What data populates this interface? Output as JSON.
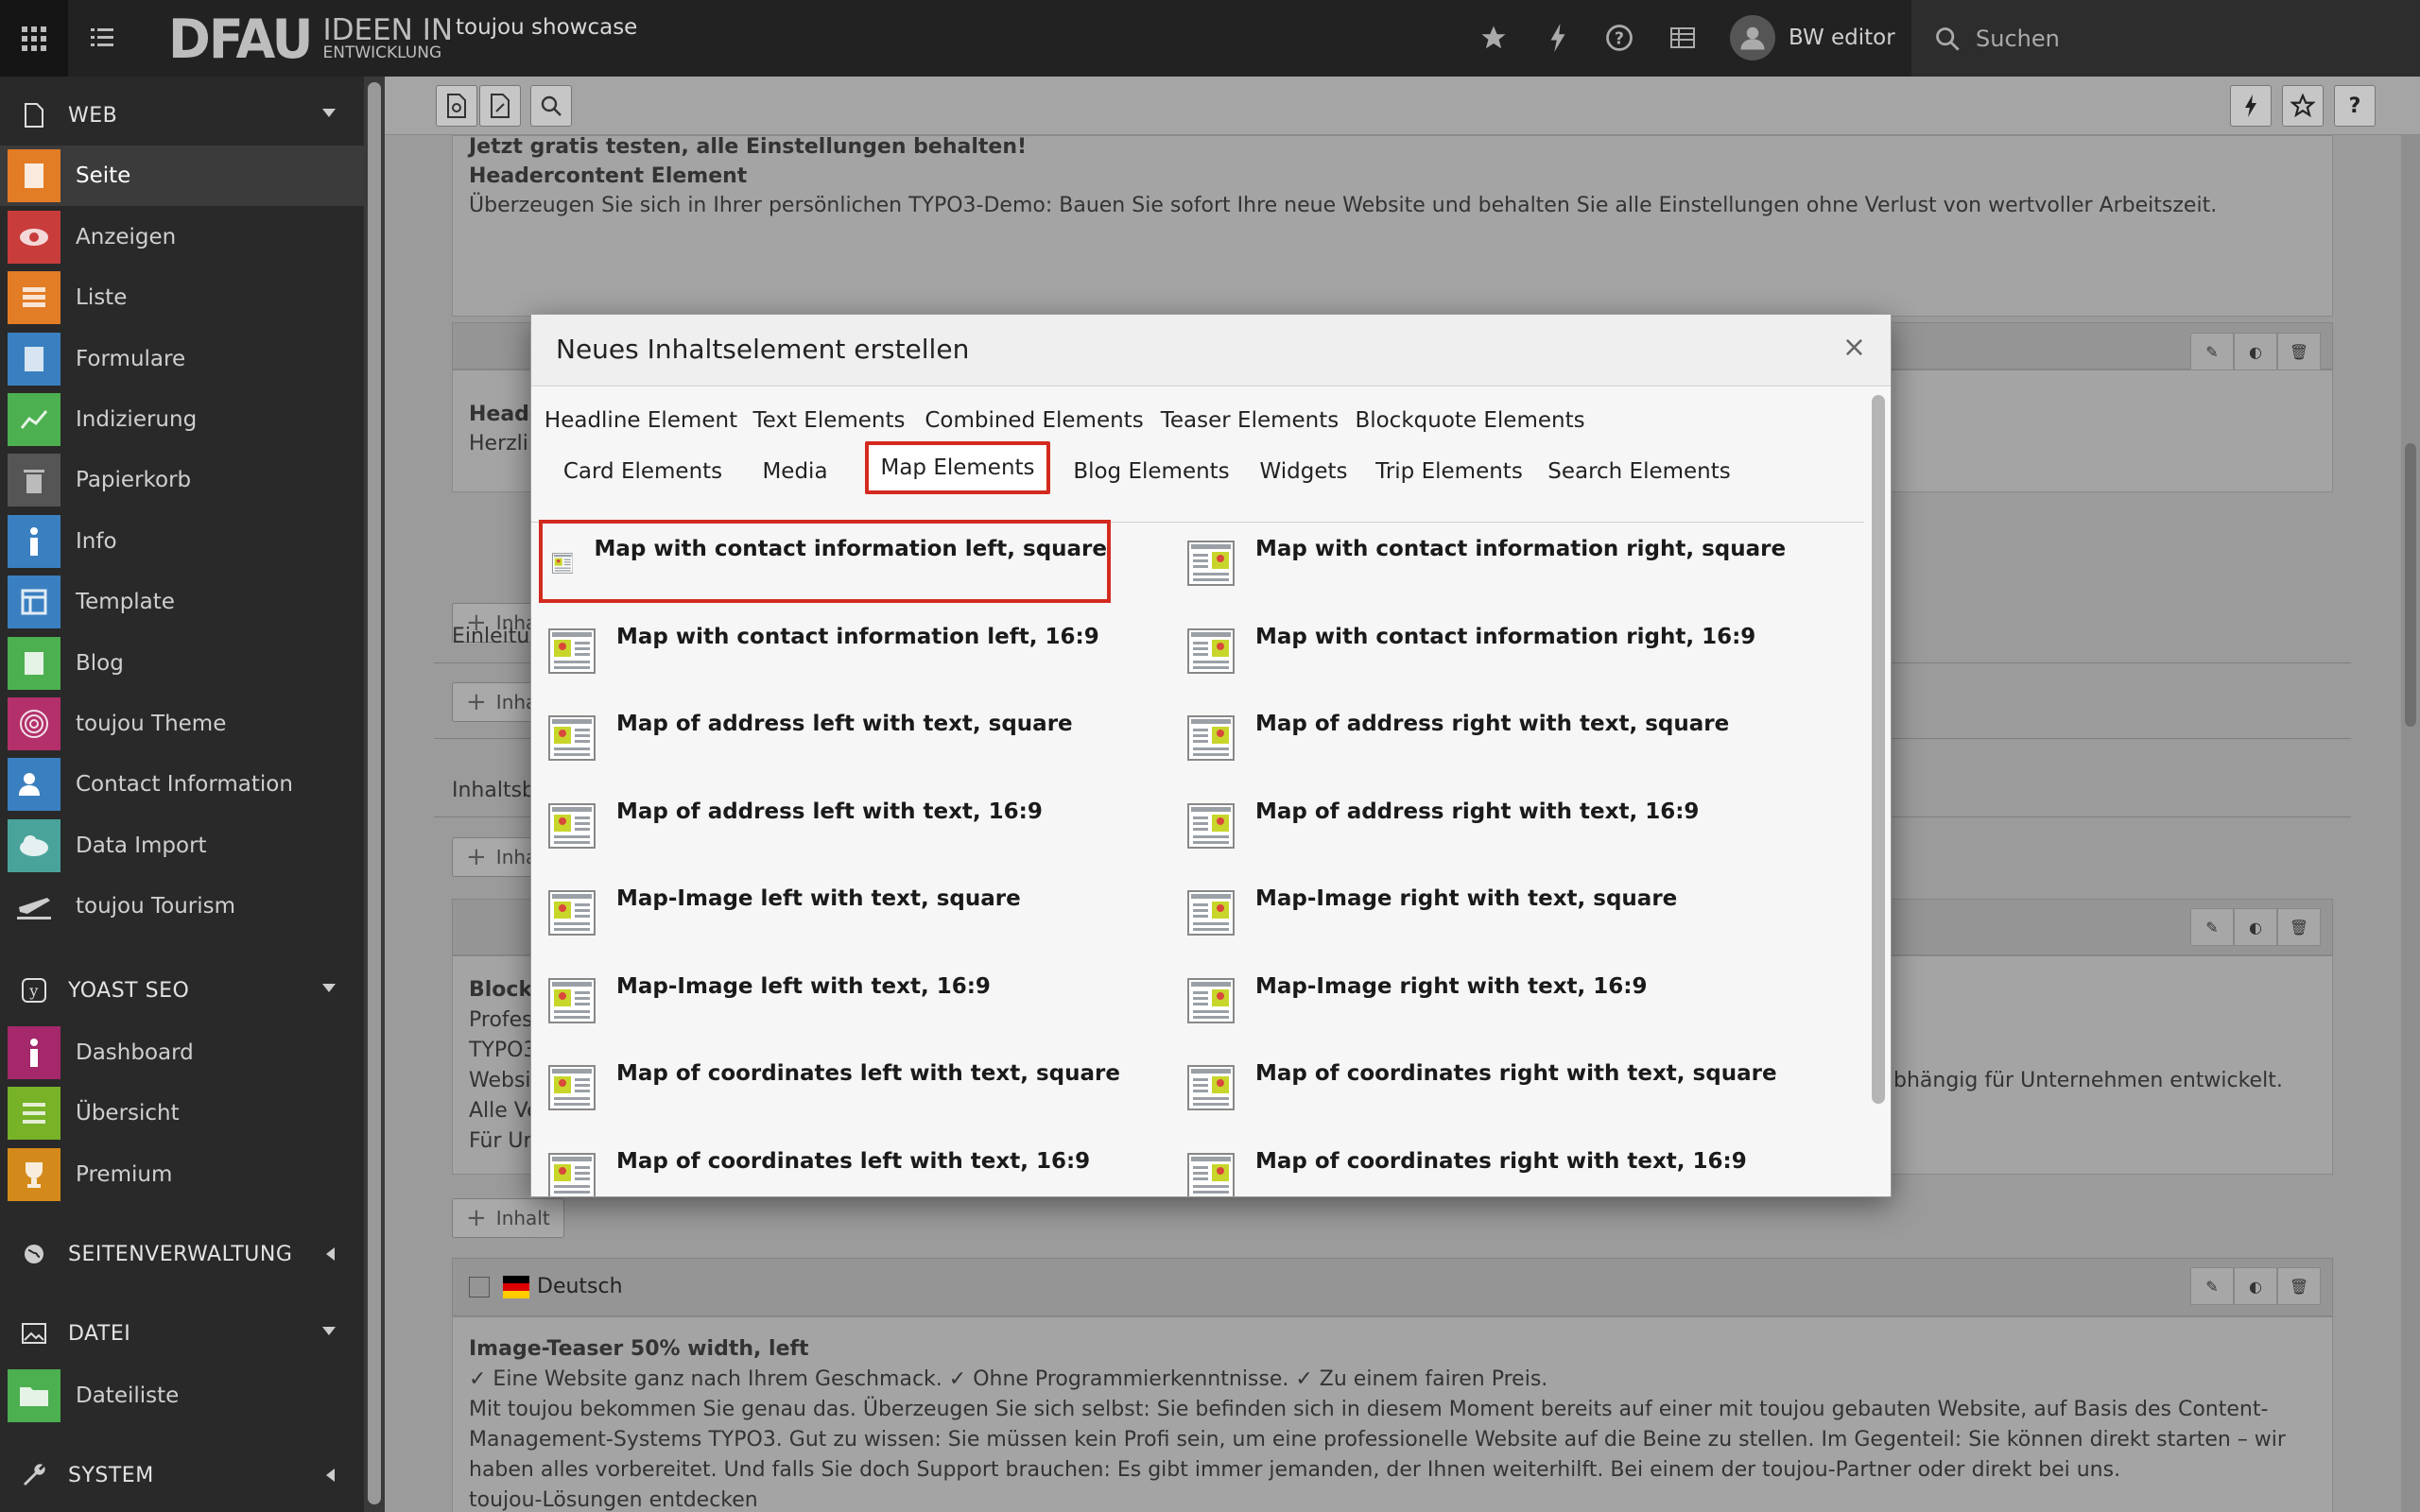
{
  "topbar": {
    "logo_main": "DFAU",
    "logo_line1": "IDEEN IN",
    "logo_line2": "ENTWICKLUNG",
    "site_name": "toujou showcase",
    "user_name": "BW editor",
    "search_placeholder": "Suchen"
  },
  "sidebar": {
    "groups": [
      {
        "label": "WEB",
        "icon": "page-icon"
      },
      {
        "label": "YOAST SEO",
        "icon": "yoast-icon"
      },
      {
        "label": "SEITENVERWALTUNG",
        "icon": "globe-icon"
      },
      {
        "label": "DATEI",
        "icon": "image-icon"
      },
      {
        "label": "SYSTEM",
        "icon": "wrench-icon"
      }
    ],
    "web_items": [
      {
        "label": "Seite",
        "color": "#e27c25"
      },
      {
        "label": "Anzeigen",
        "color": "#c83c3c"
      },
      {
        "label": "Liste",
        "color": "#e27c25"
      },
      {
        "label": "Formulare",
        "color": "#3a80c1"
      },
      {
        "label": "Indizierung",
        "color": "#4caf50"
      },
      {
        "label": "Papierkorb",
        "color": "#555555"
      },
      {
        "label": "Info",
        "color": "#3a80c1"
      },
      {
        "label": "Template",
        "color": "#3a80c1"
      },
      {
        "label": "Blog",
        "color": "#4caf50"
      },
      {
        "label": "toujou Theme",
        "color": "#b3306a"
      },
      {
        "label": "Contact Information",
        "color": "#3a80c1"
      },
      {
        "label": "Data Import",
        "color": "#4aa39b"
      },
      {
        "label": "toujou Tourism",
        "color": "#292929"
      }
    ],
    "yoast_items": [
      {
        "label": "Dashboard",
        "color": "#a4286a"
      },
      {
        "label": "Übersicht",
        "color": "#77b227"
      },
      {
        "label": "Premium",
        "color": "#d48a1a"
      }
    ],
    "datei_items": [
      {
        "label": "Dateiliste",
        "color": "#4caf50"
      }
    ]
  },
  "content": {
    "block1_line1": "Jetzt gratis testen, alle Einstellungen behalten!",
    "block1_line2": "Headercontent Element",
    "block1_line3": "Überzeugen Sie sich in Ihrer persönlichen TYPO3-Demo: Bauen Sie sofort Ihre neue Website und behalten Sie alle Einstellungen ohne Verlust von wertvoller Arbeitszeit.",
    "inhalt_label": "Inhalt",
    "inhalt_partial": "Inhal",
    "block2_head": "Heade",
    "block2_text": "Herzli",
    "section_einleitung": "Einleitu",
    "section_inhalt": "Inhaltsb",
    "block3_title": "Block",
    "block3_lines": [
      "Profes",
      "TYPO3",
      "Websi",
      "Alle Ve",
      "Für Ur"
    ],
    "block3_right": "bhängig für Unternehmen entwickelt.",
    "lang_label": "Deutsch",
    "block4_title": "Image-Teaser 50% width, left",
    "block4_lines": [
      "✓ Eine Website ganz nach Ihrem Geschmack.  ✓ Ohne Programmierkenntnisse. ✓ Zu einem fairen Preis.",
      "Mit toujou bekommen Sie genau das. Überzeugen Sie sich selbst: Sie befinden sich in diesem Moment bereits auf einer mit toujou gebauten Website, auf Basis des Content-",
      "Management-Systems TYPO3. Gut zu wissen: Sie müssen kein Profi sein, um eine professionelle Website auf die Beine zu stellen. Im Gegenteil: Sie können direkt starten – wir",
      "haben alles vorbereitet. Und falls Sie doch Support brauchen: Es gibt immer jemanden, der Ihnen weiterhilft. Bei einem der toujou-Partner oder direkt bei uns.",
      "toujou-Lösungen entdecken"
    ]
  },
  "modal": {
    "title": "Neues Inhaltselement erstellen",
    "close": "×",
    "tabs_row1": [
      "Headline Element",
      "Text Elements",
      "Combined Elements",
      "Teaser Elements",
      "Blockquote Elements"
    ],
    "tabs_row2": [
      "Card Elements",
      "Media",
      "Map Elements",
      "Blog Elements",
      "Widgets",
      "Trip Elements",
      "Search Elements"
    ],
    "active_tab": "Map Elements",
    "elements_left": [
      "Map with contact information left, square",
      "Map with contact information left, 16:9",
      "Map of address left with text, square",
      "Map of address left with text, 16:9",
      "Map-Image left with text, square",
      "Map-Image left with text, 16:9",
      "Map of coordinates left with text, square",
      "Map of coordinates left with text, 16:9"
    ],
    "elements_right": [
      "Map with contact information right, square",
      "Map with contact information right, 16:9",
      "Map of address right with text, square",
      "Map of address right with text, 16:9",
      "Map-Image right with text, square",
      "Map-Image right with text, 16:9",
      "Map of coordinates right with text, square",
      "Map of coordinates right with text, 16:9"
    ],
    "selected_element": "Map with contact information left, square"
  },
  "colors": {
    "accent_red": "#d32a1f",
    "map_icon_yellow": "#c8d62b",
    "map_pin_red": "#d9483b"
  }
}
